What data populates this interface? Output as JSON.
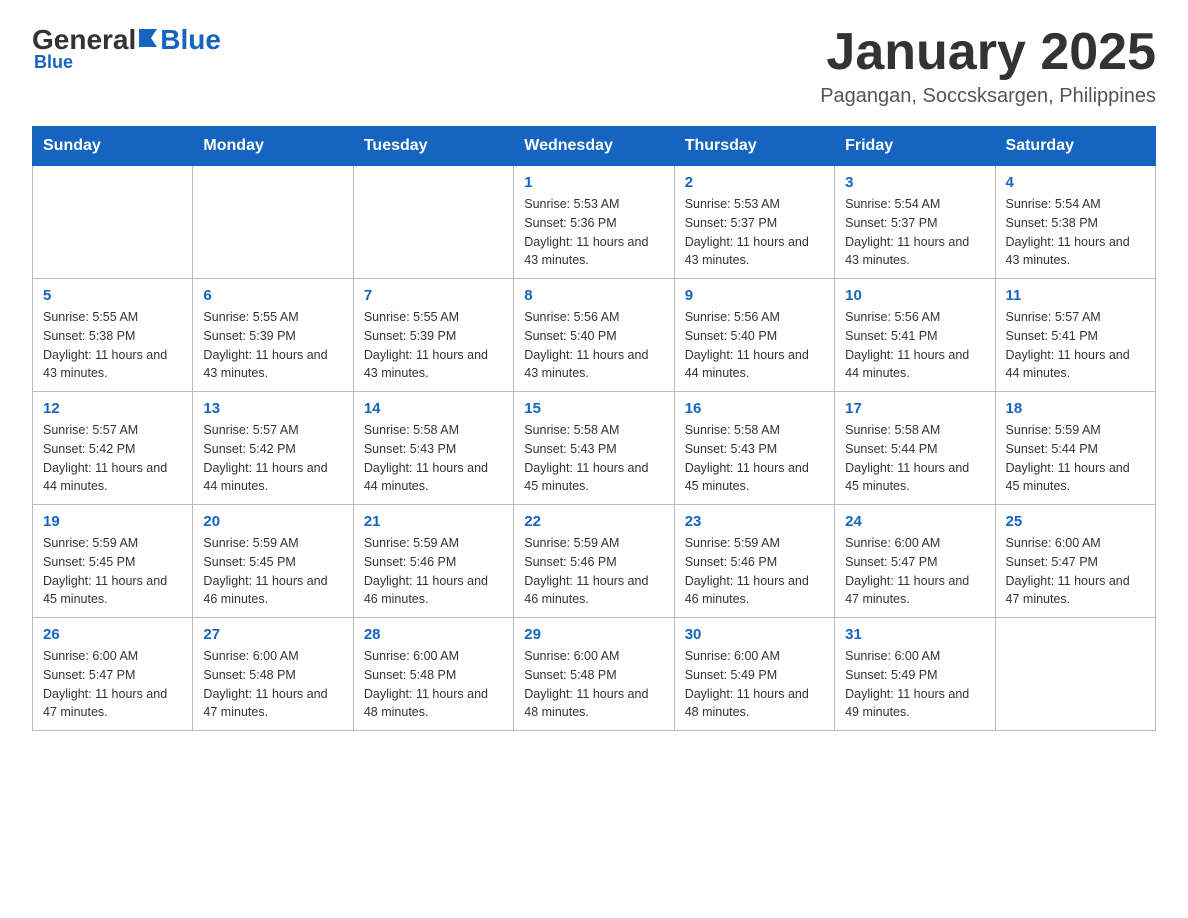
{
  "header": {
    "logo_general": "General",
    "logo_blue": "Blue",
    "month_title": "January 2025",
    "location": "Pagangan, Soccsksargen, Philippines"
  },
  "days_of_week": [
    "Sunday",
    "Monday",
    "Tuesday",
    "Wednesday",
    "Thursday",
    "Friday",
    "Saturday"
  ],
  "weeks": [
    [
      {
        "day": "",
        "info": ""
      },
      {
        "day": "",
        "info": ""
      },
      {
        "day": "",
        "info": ""
      },
      {
        "day": "1",
        "info": "Sunrise: 5:53 AM\nSunset: 5:36 PM\nDaylight: 11 hours and 43 minutes."
      },
      {
        "day": "2",
        "info": "Sunrise: 5:53 AM\nSunset: 5:37 PM\nDaylight: 11 hours and 43 minutes."
      },
      {
        "day": "3",
        "info": "Sunrise: 5:54 AM\nSunset: 5:37 PM\nDaylight: 11 hours and 43 minutes."
      },
      {
        "day": "4",
        "info": "Sunrise: 5:54 AM\nSunset: 5:38 PM\nDaylight: 11 hours and 43 minutes."
      }
    ],
    [
      {
        "day": "5",
        "info": "Sunrise: 5:55 AM\nSunset: 5:38 PM\nDaylight: 11 hours and 43 minutes."
      },
      {
        "day": "6",
        "info": "Sunrise: 5:55 AM\nSunset: 5:39 PM\nDaylight: 11 hours and 43 minutes."
      },
      {
        "day": "7",
        "info": "Sunrise: 5:55 AM\nSunset: 5:39 PM\nDaylight: 11 hours and 43 minutes."
      },
      {
        "day": "8",
        "info": "Sunrise: 5:56 AM\nSunset: 5:40 PM\nDaylight: 11 hours and 43 minutes."
      },
      {
        "day": "9",
        "info": "Sunrise: 5:56 AM\nSunset: 5:40 PM\nDaylight: 11 hours and 44 minutes."
      },
      {
        "day": "10",
        "info": "Sunrise: 5:56 AM\nSunset: 5:41 PM\nDaylight: 11 hours and 44 minutes."
      },
      {
        "day": "11",
        "info": "Sunrise: 5:57 AM\nSunset: 5:41 PM\nDaylight: 11 hours and 44 minutes."
      }
    ],
    [
      {
        "day": "12",
        "info": "Sunrise: 5:57 AM\nSunset: 5:42 PM\nDaylight: 11 hours and 44 minutes."
      },
      {
        "day": "13",
        "info": "Sunrise: 5:57 AM\nSunset: 5:42 PM\nDaylight: 11 hours and 44 minutes."
      },
      {
        "day": "14",
        "info": "Sunrise: 5:58 AM\nSunset: 5:43 PM\nDaylight: 11 hours and 44 minutes."
      },
      {
        "day": "15",
        "info": "Sunrise: 5:58 AM\nSunset: 5:43 PM\nDaylight: 11 hours and 45 minutes."
      },
      {
        "day": "16",
        "info": "Sunrise: 5:58 AM\nSunset: 5:43 PM\nDaylight: 11 hours and 45 minutes."
      },
      {
        "day": "17",
        "info": "Sunrise: 5:58 AM\nSunset: 5:44 PM\nDaylight: 11 hours and 45 minutes."
      },
      {
        "day": "18",
        "info": "Sunrise: 5:59 AM\nSunset: 5:44 PM\nDaylight: 11 hours and 45 minutes."
      }
    ],
    [
      {
        "day": "19",
        "info": "Sunrise: 5:59 AM\nSunset: 5:45 PM\nDaylight: 11 hours and 45 minutes."
      },
      {
        "day": "20",
        "info": "Sunrise: 5:59 AM\nSunset: 5:45 PM\nDaylight: 11 hours and 46 minutes."
      },
      {
        "day": "21",
        "info": "Sunrise: 5:59 AM\nSunset: 5:46 PM\nDaylight: 11 hours and 46 minutes."
      },
      {
        "day": "22",
        "info": "Sunrise: 5:59 AM\nSunset: 5:46 PM\nDaylight: 11 hours and 46 minutes."
      },
      {
        "day": "23",
        "info": "Sunrise: 5:59 AM\nSunset: 5:46 PM\nDaylight: 11 hours and 46 minutes."
      },
      {
        "day": "24",
        "info": "Sunrise: 6:00 AM\nSunset: 5:47 PM\nDaylight: 11 hours and 47 minutes."
      },
      {
        "day": "25",
        "info": "Sunrise: 6:00 AM\nSunset: 5:47 PM\nDaylight: 11 hours and 47 minutes."
      }
    ],
    [
      {
        "day": "26",
        "info": "Sunrise: 6:00 AM\nSunset: 5:47 PM\nDaylight: 11 hours and 47 minutes."
      },
      {
        "day": "27",
        "info": "Sunrise: 6:00 AM\nSunset: 5:48 PM\nDaylight: 11 hours and 47 minutes."
      },
      {
        "day": "28",
        "info": "Sunrise: 6:00 AM\nSunset: 5:48 PM\nDaylight: 11 hours and 48 minutes."
      },
      {
        "day": "29",
        "info": "Sunrise: 6:00 AM\nSunset: 5:48 PM\nDaylight: 11 hours and 48 minutes."
      },
      {
        "day": "30",
        "info": "Sunrise: 6:00 AM\nSunset: 5:49 PM\nDaylight: 11 hours and 48 minutes."
      },
      {
        "day": "31",
        "info": "Sunrise: 6:00 AM\nSunset: 5:49 PM\nDaylight: 11 hours and 49 minutes."
      },
      {
        "day": "",
        "info": ""
      }
    ]
  ]
}
